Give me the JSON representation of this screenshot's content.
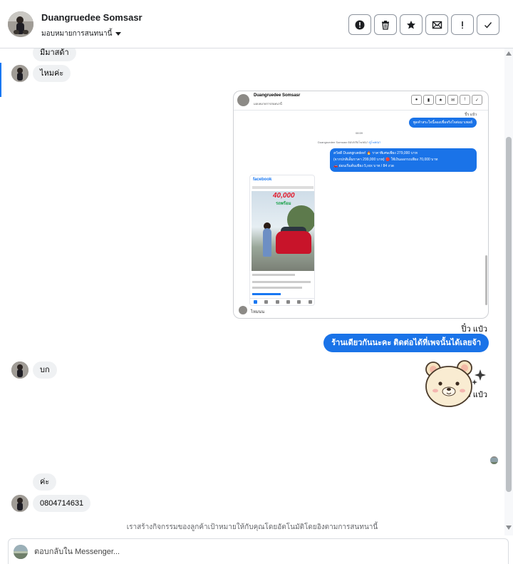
{
  "header": {
    "contact_name": "Duangruedee Somsasr",
    "assign_label": "มอบหมายการสนทนานี้",
    "actions": [
      {
        "icon": "alert-circle-icon",
        "glyph": "!"
      },
      {
        "icon": "trash-icon",
        "glyph": ""
      },
      {
        "icon": "star-icon",
        "glyph": "★"
      },
      {
        "icon": "mark-unread-icon",
        "glyph": ""
      },
      {
        "icon": "exclamation-icon",
        "glyph": "!"
      },
      {
        "icon": "checkmark-icon",
        "glyph": "✓"
      }
    ]
  },
  "thread": {
    "msg_1": "มีมาสด้า",
    "msg_2": "ไหมค่ะ",
    "page_sender_1": "ปิ๋ว แป๋ว",
    "msg_out_1": "ร้านเดียวกันนะคะ ติดต่อได้ที่เพจนั้นได้เลยจ้า",
    "msg_3": "บก",
    "page_sender_2": "ปิ๋ว แป๋ว",
    "msg_4": "ค่ะ",
    "msg_5": "0804714631",
    "footnote": "เราสร้างกิจกรรมของลูกค้าเป้าหมายให้กับคุณโดยอัตโนมัติโดยอิงตามการสนทนานี้"
  },
  "shared_screenshot": {
    "contact_name": "Duangruedee Somsasr",
    "sub_label": "มอบหมายการสนทนานี้",
    "sender": "ปิ๋ว แป๋ว",
    "bubble_1": "พูดคำสระใจนี้ลองเพื่อจริงใจต่อมาเพลย์",
    "time": "08:59",
    "system_line": "Duangruedee Somsasr ตอบกลับโฆษณา",
    "system_link": "ดูโฆษณา",
    "offer_line_1": "สวัสดี Duangruedee! 🔥 ราคาพิเศษเพียง 279,000 บาท",
    "offer_line_2": "(จากปกติเต็มราคา 299,000 บาท) 🔴 ใช้เงินออกรถเพียง 70,000 บาท",
    "offer_line_3": "🚗 ผ่อนเริ่มต้นเพียง 5,xxx บาท / 84 งวด",
    "fb_logo": "facebook",
    "price_big": "40,000",
    "price_small": "รถพร้อม",
    "reply": "ไหมนน"
  },
  "reply_box": {
    "placeholder": "ตอบกลับใน Messenger..."
  },
  "colors": {
    "accent": "#1a73e8",
    "incoming_bubble": "#eff1f3"
  }
}
